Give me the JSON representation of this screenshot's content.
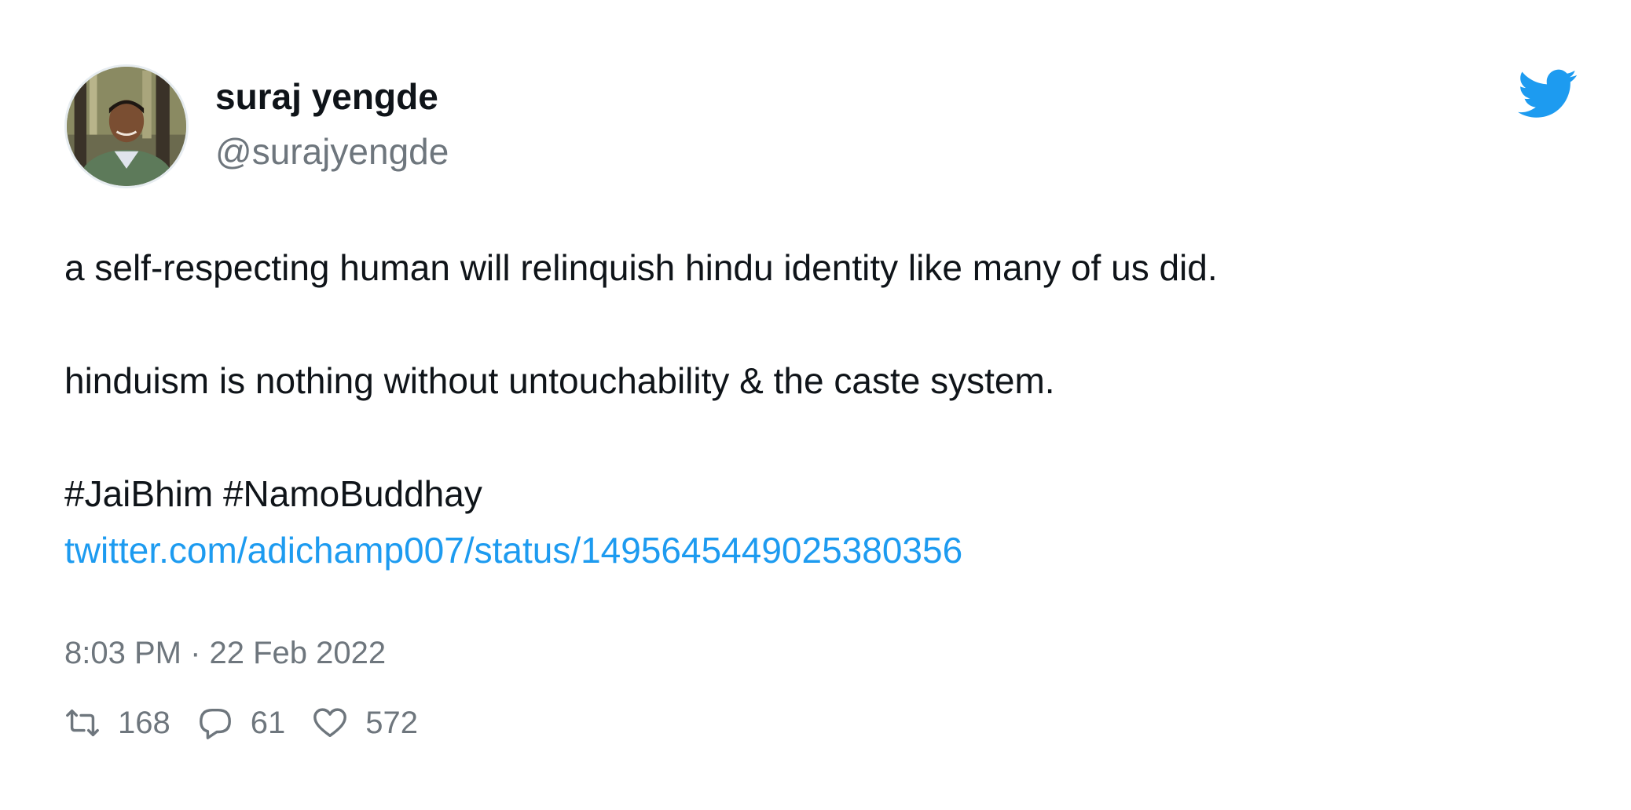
{
  "author": {
    "name": "suraj yengde",
    "handle": "@surajyengde"
  },
  "tweet": {
    "lines": [
      "a self-respecting human will relinquish hindu identity like many of us did.",
      "hinduism is nothing without untouchability & the caste system.",
      "#JaiBhim #NamoBuddhay"
    ],
    "link": "twitter.com/adichamp007/status/1495645449025380356",
    "timestamp": "8:03 PM · 22 Feb 2022"
  },
  "stats": {
    "retweets": "168",
    "replies": "61",
    "likes": "572"
  },
  "icons": {
    "brand": "twitter-bird-icon",
    "retweet": "retweet-icon",
    "reply": "reply-icon",
    "like": "heart-icon"
  },
  "colors": {
    "brand": "#1d9bf0",
    "link": "#1d9bf0",
    "muted": "#6e767d",
    "text": "#0f1419"
  }
}
